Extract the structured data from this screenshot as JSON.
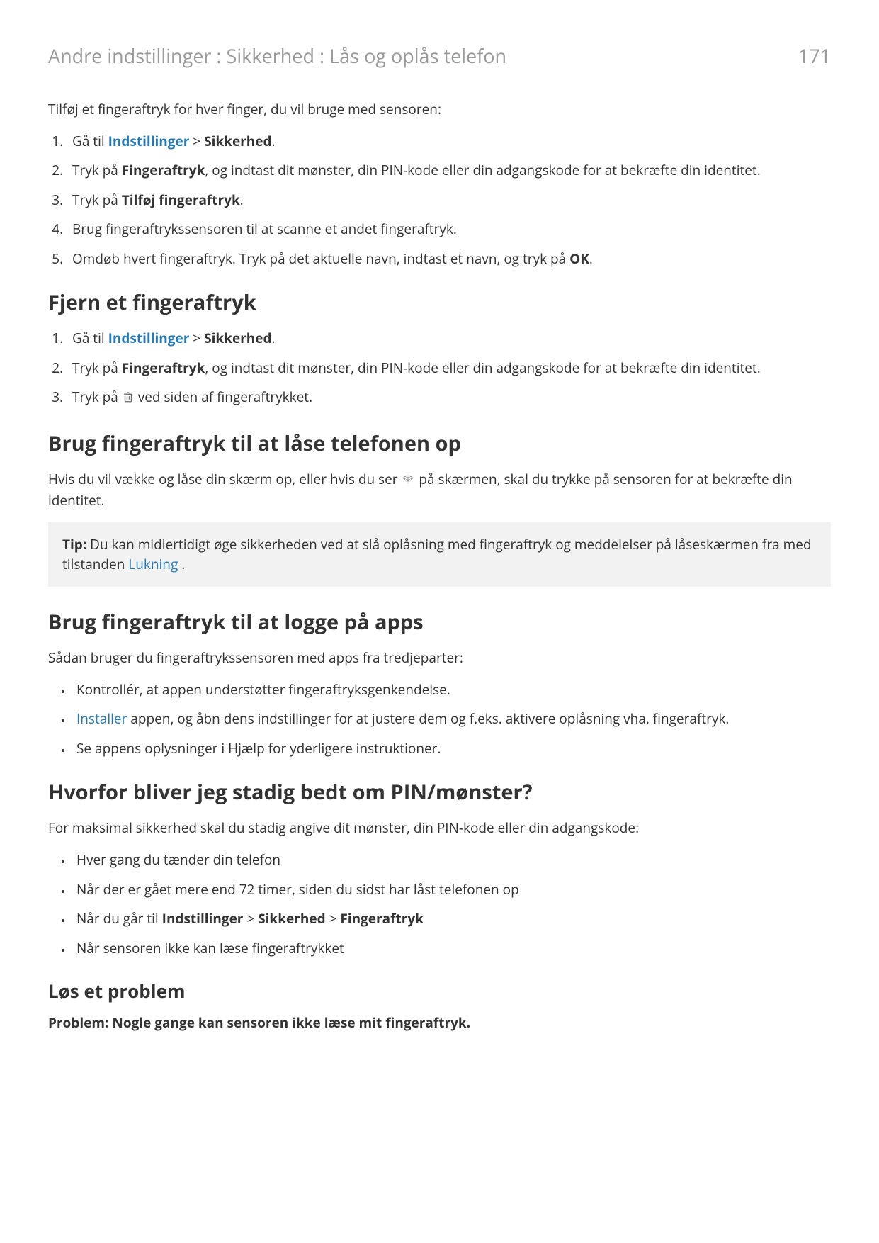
{
  "header": {
    "breadcrumb": "Andre indstillinger : Sikkerhed : Lås og oplås telefon",
    "page_number": "171"
  },
  "intro": "Tilføj et fingeraftryk for hver finger, du vil bruge med sensoren:",
  "add_list": {
    "i1a": "Gå til ",
    "i1link": "Indstillinger",
    "i1gt": " > ",
    "i1b": "Sikkerhed",
    "i1c": ".",
    "i2a": "Tryk på ",
    "i2b": "Fingeraftryk",
    "i2c": ", og indtast dit mønster, din PIN-kode eller din adgangskode for at bekræfte din identitet.",
    "i3a": "Tryk på ",
    "i3b": "Tilføj fingeraftryk",
    "i3c": ".",
    "i4": "Brug fingeraftrykssensoren til at scanne et andet fingeraftryk.",
    "i5a": "Omdøb hvert fingeraftryk. Tryk på det aktuelle navn, indtast et navn, og tryk på ",
    "i5b": "OK",
    "i5c": "."
  },
  "h_remove": "Fjern et fingeraftryk",
  "remove_list": {
    "i1a": "Gå til ",
    "i1link": "Indstillinger",
    "i1gt": " > ",
    "i1b": "Sikkerhed",
    "i1c": ".",
    "i2a": "Tryk på ",
    "i2b": "Fingeraftryk",
    "i2c": ", og indtast dit mønster, din PIN-kode eller din adgangskode for at bekræfte din identitet.",
    "i3a": "Tryk på ",
    "i3b": " ved siden af fingeraftrykket."
  },
  "h_unlock": "Brug fingeraftryk til at låse telefonen op",
  "unlock_p_a": "Hvis du vil vække og låse din skærm op, eller hvis du ser ",
  "unlock_p_b": " på skærmen, skal du trykke på sensoren for at bekræfte din identitet.",
  "tip": {
    "label": "Tip:",
    "text_a": " Du kan midlertidigt øge sikkerheden ved at slå oplåsning med fingeraftryk og meddelelser på låseskærmen fra med tilstanden ",
    "link": "Lukning",
    "text_b": " ."
  },
  "h_apps": "Brug fingeraftryk til at logge på apps",
  "apps_intro": "Sådan bruger du fingeraftrykssensoren med apps fra tredjeparter:",
  "apps_list": {
    "b1": "Kontrollér, at appen understøtter fingeraftryksgenkendelse.",
    "b2link": "Installer",
    "b2rest": " appen, og åbn dens indstillinger for at justere dem og f.eks. aktivere oplåsning vha. fingeraftryk.",
    "b3": "Se appens oplysninger i Hjælp for yderligere instruktioner."
  },
  "h_why": "Hvorfor bliver jeg stadig bedt om PIN/mønster?",
  "why_intro": "For maksimal sikkerhed skal du stadig angive dit mønster, din PIN-kode eller din adgangskode:",
  "why_list": {
    "b1": "Hver gang du tænder din telefon",
    "b2": "Når der er gået mere end 72 timer, siden du sidst har låst telefonen op",
    "b3a": "Når du går til ",
    "b3b1": "Indstillinger",
    "b3gt1": " > ",
    "b3b2": "Sikkerhed",
    "b3gt2": " > ",
    "b3b3": "Fingeraftryk",
    "b4": "Når sensoren ikke kan læse fingeraftrykket"
  },
  "h_fix": "Løs et problem",
  "fix_problem": "Problem: Nogle gange kan sensoren ikke læse mit fingeraftryk."
}
